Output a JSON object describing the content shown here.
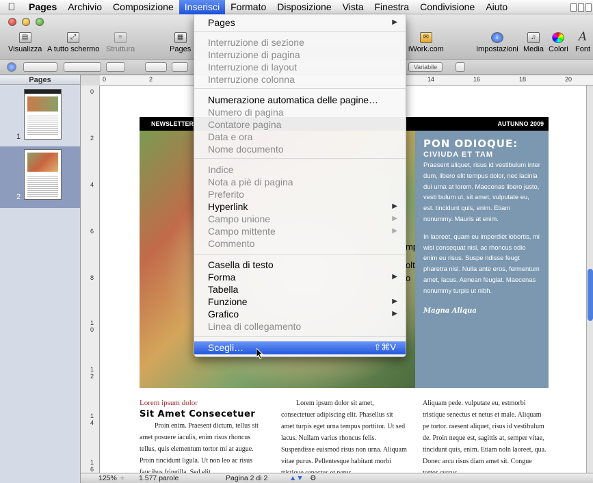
{
  "menubar": {
    "app": "Pages",
    "items": [
      "Archivio",
      "Composizione",
      "Inserisci",
      "Formato",
      "Disposizione",
      "Vista",
      "Finestra",
      "Condivisione",
      "Aiuto"
    ],
    "active": "Inserisci"
  },
  "toolbar": {
    "visualizza": "Visualizza",
    "fullscreen": "A tutto schermo",
    "struttura": "Struttura",
    "pages": "Pages",
    "iwork": "iWork.com",
    "impostazioni": "Impostazioni",
    "media": "Media",
    "colori": "Colori",
    "font": "Font"
  },
  "formatbar": {
    "variabile": "Variabile"
  },
  "sidebar": {
    "title": "Pages",
    "pages": [
      "1",
      "2"
    ],
    "selected": "2"
  },
  "ruler": {
    "h": [
      "0",
      "2",
      "14",
      "16",
      "18",
      "20"
    ],
    "v": [
      "0",
      "2",
      "4",
      "6",
      "8",
      "1\n0",
      "1\n2",
      "1\n4",
      "1\n6"
    ]
  },
  "document": {
    "banner_left": "NEWSLETTER",
    "banner_right": "AUTUNNO 2009",
    "sidebox": {
      "title": "PON ODIOQUE:",
      "subtitle": "CIVIUDA ET TAM",
      "p1": "Praesent aliquet, risus id vestibulum inter dum, libero elit tempus dolor, nec lacinia dui urna at lorem. Maecenas libero justo, vesti bulum ut, sit amet, vulputate eu, est. tincidunt quis, enim. Etiam nonummy.  Mauris at enim.",
      "p2": "In laoreet, quam eu imperdiet lobortis, mi wisi consequat nisl, ac rhoncus odio enim eu risus. Suspe ndisse feugt pharetra nisl. Nulla ante eros, fermentum amet, lacus. Aenean feugiat. Maecenas nonummy turpis ut nibh.",
      "sig": "Magna Aliqua"
    },
    "col1": {
      "kicker": "Lorem ipsum dolor",
      "heading": "Sit Amet Consecetuer",
      "body": "Proin enim. Praesent dictum, tellus sit amet posuere iaculis, enim risus rhoncus tellus, quis elementum tortor mi at augue. Proin tincidunt ligula. Ut non leo ac risus faucibus fringilla. Sed elit."
    },
    "col2": {
      "body": "Lorem ipsum dolor sit amet, consectetuer adipiscing elit. Phasellus sit amet turpis eget urna tempus porttitor. Ut sed lacus. Nullam varius rhoncus felis. Suspendisse euismod risus non urna. Aliquam vitae purus. Pellentesque habitant morbi tristique senectus et netus"
    },
    "col3": {
      "body": "Aliquam pede. vulputate eu, estmorbi tristique senectus et netus et male. Aliquam pe tortor. raesent aliquet, risus id vestibulum de. Proin neque est, sagittis at, semper vitae, tincidunt quis, enim. Etiam noln laoreet, qua. Donec arcu risus diam amet sit. Congue tortor cursus"
    },
    "peek": {
      "a": "mpo",
      "b": "olto",
      "c": "o"
    }
  },
  "statusbar": {
    "zoom": "125%",
    "words": "1.577 parole",
    "page": "Pagina 2 di 2"
  },
  "dropdown": {
    "items": [
      {
        "label": "Pages",
        "disabled": false,
        "arrow": true
      },
      {
        "label": "Interruzione di sezione",
        "disabled": true
      },
      {
        "label": "Interruzione di pagina",
        "disabled": true
      },
      {
        "label": "Interruzione di layout",
        "disabled": true
      },
      {
        "label": "Interruzione colonna",
        "disabled": true
      },
      {
        "label": "Numerazione automatica delle pagine…",
        "disabled": false
      },
      {
        "label": "Numero di pagina",
        "disabled": true
      },
      {
        "label": "Contatore pagina",
        "disabled": true
      },
      {
        "label": "Data e ora",
        "disabled": true
      },
      {
        "label": "Nome documento",
        "disabled": true
      },
      {
        "label": "Indice",
        "disabled": true
      },
      {
        "label": "Nota a piè di pagina",
        "disabled": true
      },
      {
        "label": "Preferito",
        "disabled": true
      },
      {
        "label": "Hyperlink",
        "disabled": false,
        "arrow": true
      },
      {
        "label": "Campo unione",
        "disabled": true,
        "arrow": true
      },
      {
        "label": "Campo mittente",
        "disabled": true,
        "arrow": true
      },
      {
        "label": "Commento",
        "disabled": true
      },
      {
        "label": "Casella di testo",
        "disabled": false
      },
      {
        "label": "Forma",
        "disabled": false,
        "arrow": true
      },
      {
        "label": "Tabella",
        "disabled": false
      },
      {
        "label": "Funzione",
        "disabled": false,
        "arrow": true
      },
      {
        "label": "Grafico",
        "disabled": false,
        "arrow": true
      },
      {
        "label": "Linea di collegamento",
        "disabled": true
      },
      {
        "label": "Scegli…",
        "disabled": false,
        "highlighted": true,
        "shortcut": "⇧⌘V"
      }
    ]
  }
}
